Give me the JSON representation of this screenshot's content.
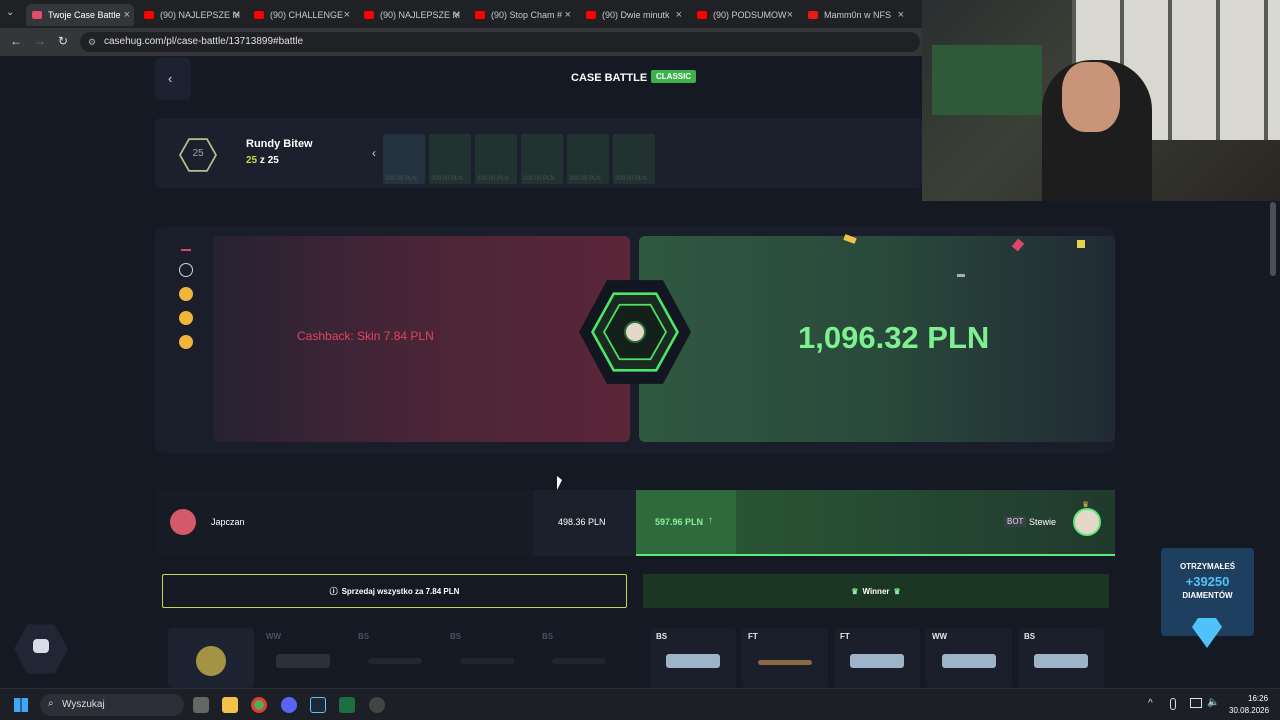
{
  "browser": {
    "tabs": [
      {
        "label": "Twoje Case Battle"
      },
      {
        "label": "(90) NAJLEPSZE M"
      },
      {
        "label": "(90) CHALLENGE"
      },
      {
        "label": "(90) NAJLEPSZE M"
      },
      {
        "label": "(90) Stop Cham #"
      },
      {
        "label": "(90) Dwie minutk"
      },
      {
        "label": "(90) PODSUMOW"
      },
      {
        "label": "Mamm0n w NFS"
      }
    ],
    "url": "casehug.com/pl/case-battle/13713899#battle"
  },
  "header": {
    "title": "CASE BATTLE",
    "badge": "CLASSIC"
  },
  "rounds": {
    "count": "25",
    "title": "Rundy Bitew",
    "current": "25",
    "sep": "z",
    "total": "25",
    "items": [
      "200.00 PLN",
      "200.00 PLN",
      "200.00 PLN",
      "200.00 PLN",
      "200.00 PLN",
      "200.00 PLN"
    ]
  },
  "result": {
    "cashback": "Cashback: Skin 7.84 PLN",
    "total": "1,096.32 PLN"
  },
  "players": {
    "left": {
      "name": "Japczan",
      "value": "498.36 PLN"
    },
    "right": {
      "value": "597.96 PLN",
      "bot_tag": "BOT",
      "name": "Stewie"
    }
  },
  "actions": {
    "sell_all": "Sprzedaj wszystko za 7.84 PLN",
    "winner": "Winner"
  },
  "left_items": [
    {
      "cond": ""
    },
    {
      "cond": "WW"
    },
    {
      "cond": "BS"
    },
    {
      "cond": "BS"
    },
    {
      "cond": "BS"
    }
  ],
  "right_items": [
    {
      "cond": "BS"
    },
    {
      "cond": "FT"
    },
    {
      "cond": "FT"
    },
    {
      "cond": "WW"
    },
    {
      "cond": "BS"
    }
  ],
  "promo": {
    "line1": "OTRZYMAŁEŚ",
    "line2": "+39250",
    "line3": "DIAMENTÓW"
  },
  "taskbar": {
    "search": "Wyszukaj",
    "time": "16:26",
    "date": "30.08.2026"
  },
  "colors": {
    "accent_green": "#5eea7a",
    "accent_red": "#e0455f",
    "badge_green": "#3bb34a"
  }
}
